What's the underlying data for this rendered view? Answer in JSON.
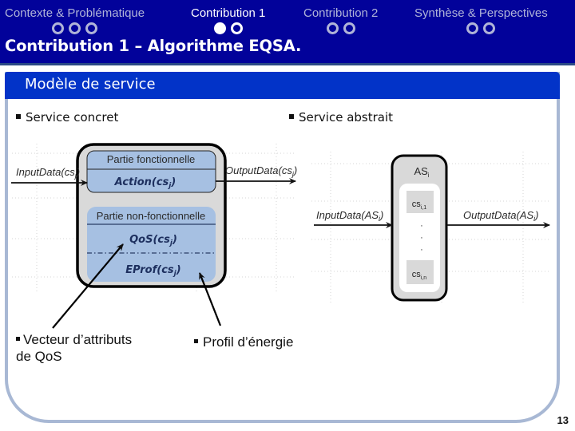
{
  "navigation": {
    "sections": [
      {
        "label": "Contexte & Problématique",
        "dots": [
          false,
          false,
          false
        ],
        "active": false
      },
      {
        "label": "Contribution 1",
        "dots": [
          true,
          false
        ],
        "active": true
      },
      {
        "label": "Contribution 2",
        "dots": [
          false,
          false
        ],
        "active": false
      },
      {
        "label": "Synthèse & Perspectives",
        "dots": [
          false,
          false
        ],
        "active": false
      }
    ]
  },
  "slide": {
    "title": "Contribution 1 – Algorithme EQSA.",
    "panel_title": "Modèle de service",
    "page_number": "13"
  },
  "bullets": {
    "concrete": "Service concret",
    "abstract": "Service abstrait"
  },
  "concrete_diagram": {
    "input_label": "InputData(cs",
    "output_label": "OutputData(cs",
    "subscript": "j",
    "functional_title": "Partie fonctionnelle",
    "action_label": "Action(cs",
    "nonfunctional_title": "Partie non-fonctionnelle",
    "qos_label": "QoS(cs",
    "eprof_label": "EProf(cs"
  },
  "abstract_diagram": {
    "title": "AS",
    "title_sub": "i",
    "input_label": "InputData(AS",
    "output_label": "OutputData(AS",
    "subscript": "i",
    "first_cs": "cs",
    "first_cs_sub": "i,1",
    "last_cs": "cs",
    "last_cs_sub": "i,n",
    "ellipsis": "·"
  },
  "callouts": {
    "qos_vector_line1": "Vecteur d’attributs",
    "qos_vector_line2": "de QoS",
    "energy_profile": "Profil d’énergie"
  },
  "colors": {
    "header_bg": "#02029a",
    "panel_header_bg": "#0233c8",
    "panel_frame": "#a8b8d4",
    "part_fill": "#a6c0e2",
    "outer_fill": "#d9d9d9"
  }
}
